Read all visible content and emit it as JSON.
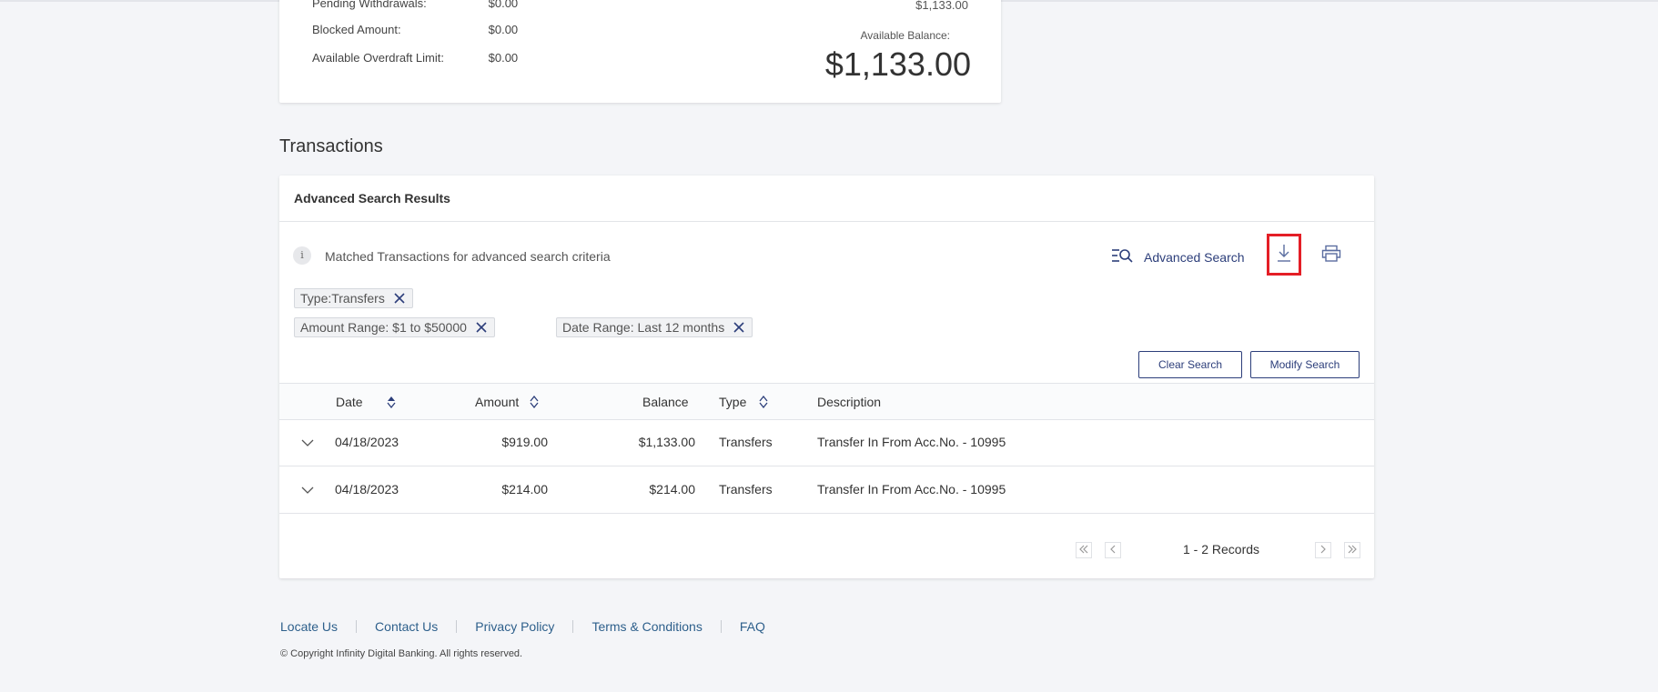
{
  "summary": {
    "rows": [
      {
        "label": "Pending Withdrawals:",
        "value": "$0.00"
      },
      {
        "label": "Blocked Amount:",
        "value": "$0.00"
      },
      {
        "label": "Available Overdraft Limit:",
        "value": "$0.00"
      }
    ],
    "top_right_value": "$1,133.00",
    "available_balance_label": "Available Balance:",
    "available_balance_value": "$1,133.00"
  },
  "transactions": {
    "section_title": "Transactions",
    "card_title": "Advanced Search Results",
    "info_icon_glyph": "i",
    "info_text": "Matched Transactions for advanced search criteria",
    "advanced_search_label": "Advanced Search",
    "icons": {
      "advanced_search": "search-filter-icon",
      "download": "download-icon",
      "print": "print-icon",
      "chip_remove": "close-icon",
      "row_expand": "chevron-down-icon"
    },
    "filters": [
      {
        "label": "Type:Transfers"
      },
      {
        "label": "Amount Range: $1 to $50000"
      },
      {
        "label": "Date Range: Last 12 months"
      }
    ],
    "clear_search_label": "Clear Search",
    "modify_search_label": "Modify Search",
    "columns": {
      "date": "Date",
      "amount": "Amount",
      "balance": "Balance",
      "type": "Type",
      "description": "Description"
    },
    "rows": [
      {
        "date": "04/18/2023",
        "amount": "$919.00",
        "balance": "$1,133.00",
        "type": "Transfers",
        "description": "Transfer In From Acc.No. - 10995"
      },
      {
        "date": "04/18/2023",
        "amount": "$214.00",
        "balance": "$214.00",
        "type": "Transfers",
        "description": "Transfer In From Acc.No. - 10995"
      }
    ],
    "pagination_text": "1 - 2 Records"
  },
  "footer": {
    "links": [
      "Locate Us",
      "Contact Us",
      "Privacy Policy",
      "Terms & Conditions",
      "FAQ"
    ],
    "copyright": "© Copyright Infinity Digital Banking. All rights reserved."
  },
  "colors": {
    "accent": "#2c3e7a",
    "highlight": "#e41e26",
    "link": "#2d5f8b",
    "background": "#f4f5f8"
  }
}
